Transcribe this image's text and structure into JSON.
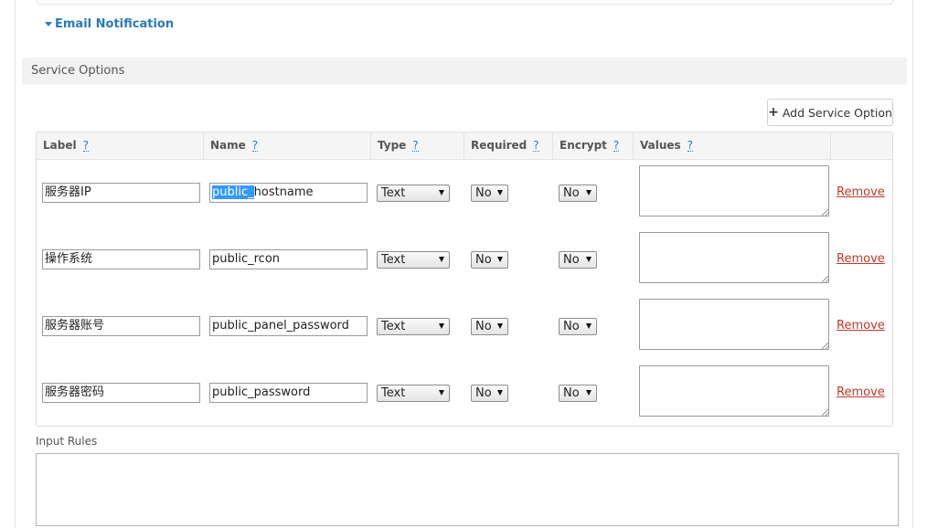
{
  "email_notification": {
    "label": "Email Notification"
  },
  "service_options": {
    "section_title": "Service Options",
    "add_button_label": "Add Service Option",
    "columns": [
      {
        "label": "Label",
        "help": "?"
      },
      {
        "label": "Name",
        "help": "?"
      },
      {
        "label": "Type",
        "help": "?"
      },
      {
        "label": "Required",
        "help": "?"
      },
      {
        "label": "Encrypt",
        "help": "?"
      },
      {
        "label": "Values",
        "help": "?"
      }
    ],
    "rows": [
      {
        "label": "服务器IP",
        "name_selected": "public_",
        "name_rest": "hostname",
        "type": "Text",
        "required": "No",
        "encrypt": "No",
        "values": "",
        "remove": "Remove"
      },
      {
        "label": "操作系统",
        "name": "public_rcon",
        "type": "Text",
        "required": "No",
        "encrypt": "No",
        "values": "",
        "remove": "Remove"
      },
      {
        "label": "服务器账号",
        "name": "public_panel_password",
        "type": "Text",
        "required": "No",
        "encrypt": "No",
        "values": "",
        "remove": "Remove"
      },
      {
        "label": "服务器密码",
        "name": "public_password",
        "type": "Text",
        "required": "No",
        "encrypt": "No",
        "values": "",
        "remove": "Remove"
      }
    ]
  },
  "input_rules": {
    "label": "Input Rules",
    "value": ""
  }
}
